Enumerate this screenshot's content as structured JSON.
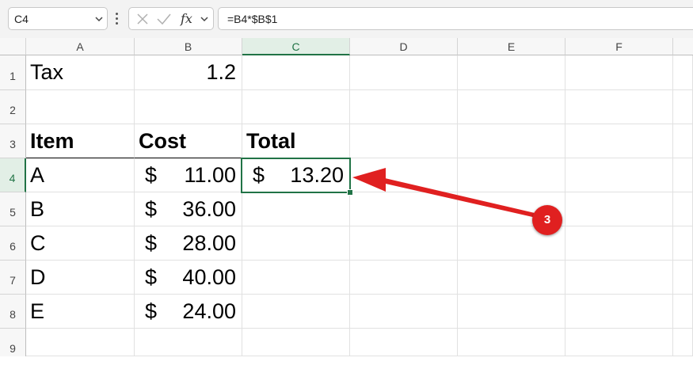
{
  "formula_bar": {
    "name_box": "C4",
    "formula": "=B4*$B$1",
    "icons": [
      "chevron-down-icon",
      "more-options-icon",
      "cancel-icon",
      "enter-icon",
      "insert-function-icon"
    ]
  },
  "grid": {
    "columns": [
      "A",
      "B",
      "C",
      "D",
      "E",
      "F"
    ],
    "rows": [
      "1",
      "2",
      "3",
      "4",
      "5",
      "6",
      "7",
      "8",
      "9"
    ],
    "cells": {
      "A1": "Tax",
      "B1": "1.2",
      "A3": "Item",
      "B3": "Cost",
      "C3": "Total",
      "A4": "A",
      "A5": "B",
      "A6": "C",
      "A7": "D",
      "A8": "E",
      "B4": "11.00",
      "B5": "36.00",
      "B6": "28.00",
      "B7": "40.00",
      "B8": "24.00",
      "C4": "13.20",
      "currency_symbol": "$"
    },
    "selected_cell": "C4"
  },
  "annotation": {
    "badge": "3"
  },
  "colors": {
    "selection": "#217346",
    "annotation": "#e02020"
  }
}
